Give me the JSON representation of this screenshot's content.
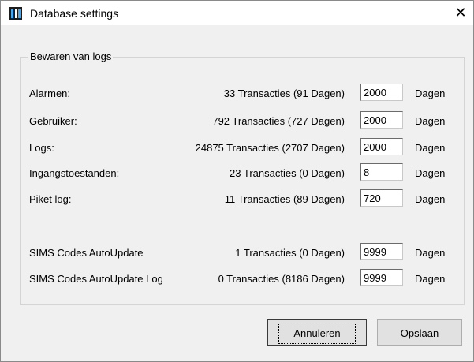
{
  "window": {
    "title": "Database settings",
    "close_label": "✕"
  },
  "group": {
    "legend": "Bewaren van logs"
  },
  "rows": [
    {
      "label": "Alarmen:",
      "count": "33  Transacties (91 Dagen)",
      "value": "2000",
      "unit": "Dagen"
    },
    {
      "label": "Gebruiker:",
      "count": "792  Transacties (727 Dagen)",
      "value": "2000",
      "unit": "Dagen"
    },
    {
      "label": "Logs:",
      "count": "24875  Transacties (2707 Dagen)",
      "value": "2000",
      "unit": "Dagen"
    },
    {
      "label": "Ingangstoestanden:",
      "count": "23  Transacties (0 Dagen)",
      "value": "8",
      "unit": "Dagen"
    },
    {
      "label": "Piket log:",
      "count": "11  Transacties (89 Dagen)",
      "value": "720",
      "unit": "Dagen"
    },
    {
      "label": "SIMS Codes AutoUpdate",
      "count": "1  Transacties (0 Dagen)",
      "value": "9999",
      "unit": "Dagen"
    },
    {
      "label": "SIMS Codes AutoUpdate Log",
      "count": "0  Transacties (8186 Dagen)",
      "value": "9999",
      "unit": "Dagen"
    }
  ],
  "buttons": {
    "cancel": "Annuleren",
    "save": "Opslaan"
  }
}
